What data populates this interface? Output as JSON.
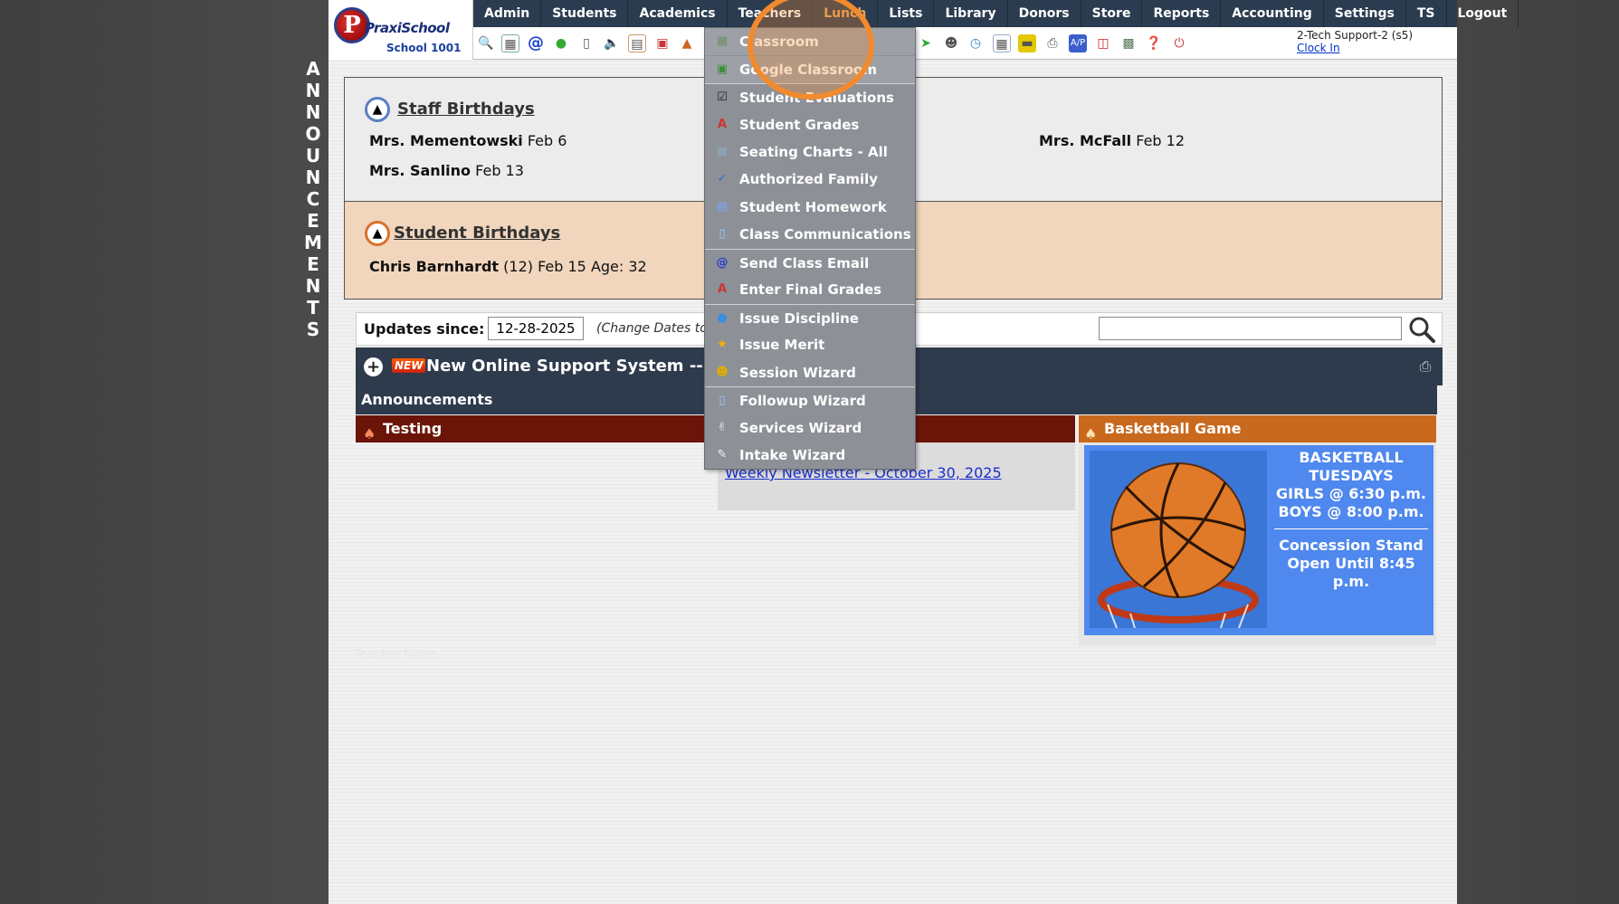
{
  "sidebar_vertical": [
    "A",
    "N",
    "N",
    "O",
    "U",
    "N",
    "C",
    "E",
    "M",
    "E",
    "N",
    "T",
    "S"
  ],
  "logo": {
    "letter": "P",
    "brand": "PraxiSchool",
    "school": "School 1001"
  },
  "nav": {
    "items": [
      "Admin",
      "Students",
      "Academics",
      "Teachers",
      "Lunch",
      "Lists",
      "Library",
      "Donors",
      "Store",
      "Reports",
      "Accounting",
      "Settings",
      "TS",
      "Logout"
    ]
  },
  "user": {
    "name": "2-Tech Support-2 (s5)",
    "clock_in": "Clock In"
  },
  "staff_birthdays": {
    "title": "Staff Birthdays",
    "entries": [
      {
        "name": "Mrs. Mementowski",
        "date": "Feb 6"
      },
      {
        "name": "Mrs. Sanlino",
        "date": "Feb 13"
      },
      {
        "name": "Mrs. McFall",
        "date": "Feb 12"
      }
    ]
  },
  "student_birthdays": {
    "title": "Student Birthdays",
    "entries": [
      {
        "name": "Chris Barnhardt",
        "detail": "(12) Feb 15 Age: 32"
      }
    ]
  },
  "updates": {
    "label": "Updates since:",
    "date": "12-28-2025",
    "change_hint": "(Change Dates to s",
    "search_value": ""
  },
  "support": {
    "badge": "NEW",
    "text": "New Online Support System -- ",
    "highlight": "01"
  },
  "announcements_label": "Announcements",
  "testing": {
    "title": "Testing",
    "link": "Weekly Newsletter - October 30, 2025"
  },
  "basketball": {
    "title": "Basketball Game",
    "lines": [
      "BASKETBALL",
      "TUESDAYS",
      "GIRLS @ 6:30 p.m.",
      "BOYS  @ 8:00 p.m."
    ],
    "concession": [
      "Concession Stand",
      "Open Until 8:45 p.m."
    ]
  },
  "faint_text": "Teacher Notes",
  "teachers_menu": {
    "items": [
      {
        "label": "Classroom",
        "icon": "classroom-icon"
      },
      {
        "label": "Google Classroom",
        "icon": "google-classroom-icon"
      },
      {
        "label": "Student Evaluations",
        "icon": "checkbox-icon"
      },
      {
        "label": "Student Grades",
        "icon": "grade-icon"
      },
      {
        "label": "Seating Charts - All",
        "icon": "seating-icon"
      },
      {
        "label": "Authorized Family",
        "icon": "check-icon"
      },
      {
        "label": "Student Homework",
        "icon": "book-icon"
      },
      {
        "label": "Class Communications",
        "icon": "phone-icon"
      },
      {
        "label": "Send Class Email",
        "icon": "at-icon"
      },
      {
        "label": "Enter Final Grades",
        "icon": "grade-plus-icon"
      },
      {
        "label": "Issue Discipline",
        "icon": "pin-icon"
      },
      {
        "label": "Issue Merit",
        "icon": "star-icon"
      },
      {
        "label": "Session Wizard",
        "icon": "people-icon"
      },
      {
        "label": "Followup Wizard",
        "icon": "followup-icon"
      },
      {
        "label": "Services Wizard",
        "icon": "hand-icon"
      },
      {
        "label": "Intake Wizard",
        "icon": "pen-icon"
      }
    ]
  },
  "colors": {
    "nav_bg": "#2c3c50",
    "lunch_accent": "#e6a25a",
    "highlight_ring": "#f28a2e",
    "testing_bar": "#6b1509",
    "basketball_bar": "#c9691e"
  }
}
